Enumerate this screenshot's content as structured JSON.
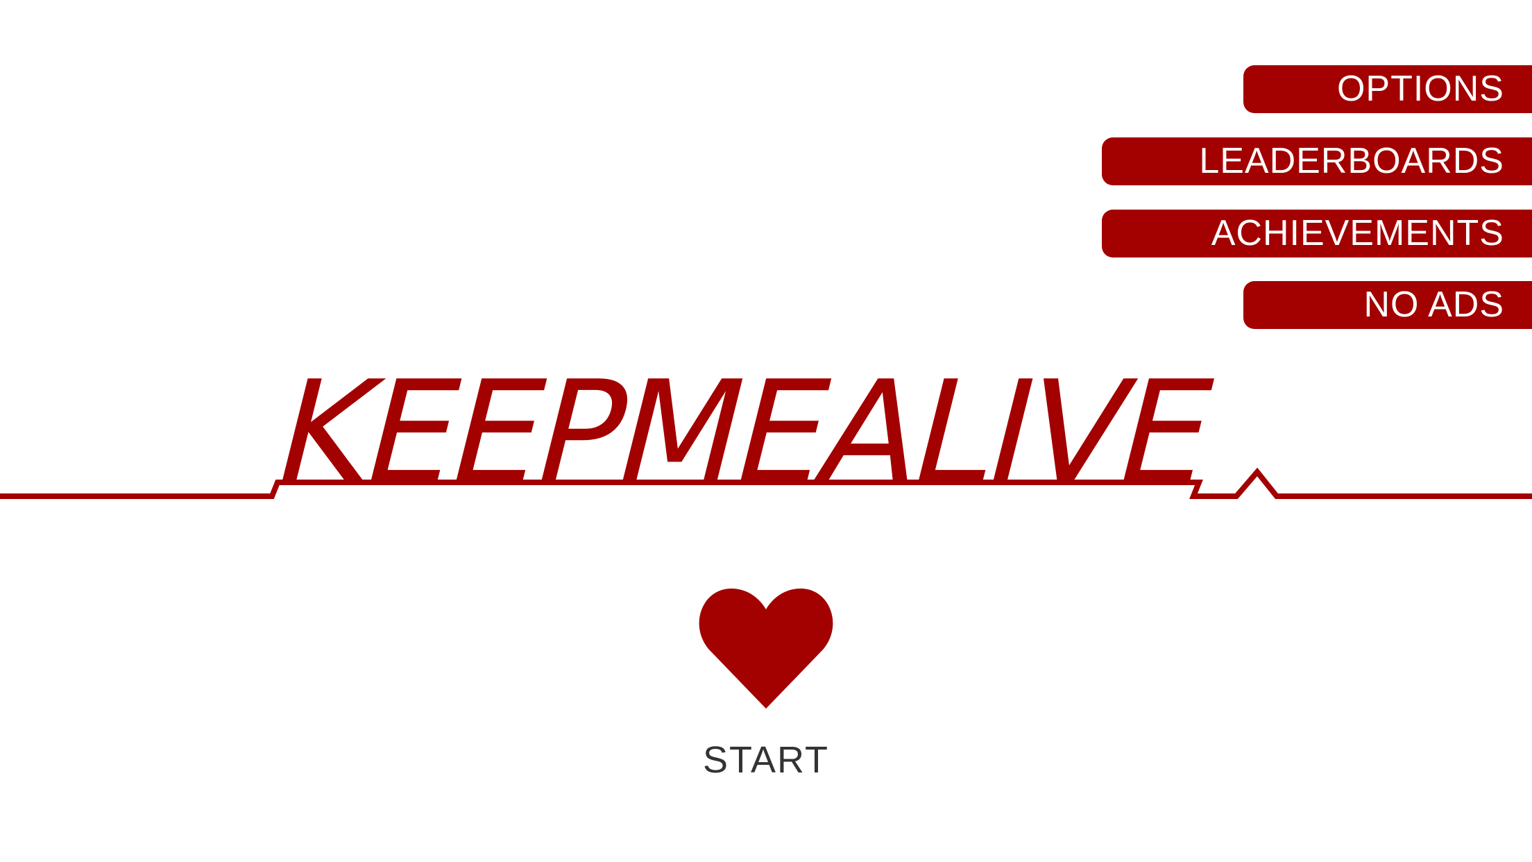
{
  "menu": {
    "options": "OPTIONS",
    "leaderboards": "LEADERBOARDS",
    "achievements": "ACHIEVEMENTS",
    "no_ads": "NO ADS"
  },
  "logo": {
    "title": "KEEPMEALIVE",
    "graphic": "heartbeat-line"
  },
  "start": {
    "icon": "heart-icon",
    "label": "START"
  },
  "colors": {
    "accent": "#a30000",
    "background": "#ffffff",
    "start_text": "#333333",
    "button_text": "#ffffff"
  }
}
